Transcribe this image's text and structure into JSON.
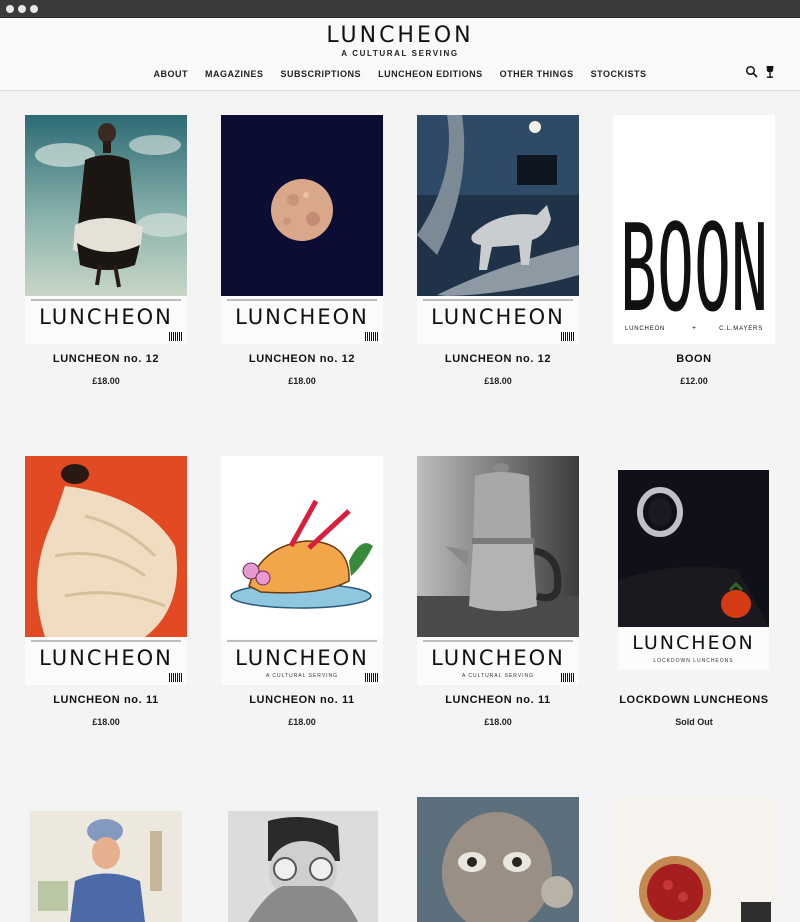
{
  "header": {
    "logo": "LUNCHEON",
    "tagline": "A CULTURAL SERVING",
    "nav": [
      "ABOUT",
      "MAGAZINES",
      "SUBSCRIPTIONS",
      "LUNCHEON EDITIONS",
      "OTHER THINGS",
      "STOCKISTS"
    ]
  },
  "products": [
    {
      "title": "LUNCHEON no. 12",
      "price": "£18.00",
      "cover_word": "LUNCHEON",
      "cover_sub": ""
    },
    {
      "title": "LUNCHEON no. 12",
      "price": "£18.00",
      "cover_word": "LUNCHEON",
      "cover_sub": ""
    },
    {
      "title": "LUNCHEON no. 12",
      "price": "£18.00",
      "cover_word": "LUNCHEON",
      "cover_sub": ""
    },
    {
      "title": "BOON",
      "price": "£12.00",
      "cover_word": "BOON",
      "cover_left": "LUNCHEON",
      "cover_mid": "+",
      "cover_right": "C.L.MAYERS"
    },
    {
      "title": "LUNCHEON no. 11",
      "price": "£18.00",
      "cover_word": "LUNCHEON",
      "cover_sub": ""
    },
    {
      "title": "LUNCHEON no. 11",
      "price": "£18.00",
      "cover_word": "LUNCHEON",
      "cover_sub": "A CULTURAL SERVING"
    },
    {
      "title": "LUNCHEON no. 11",
      "price": "£18.00",
      "cover_word": "LUNCHEON",
      "cover_sub": "A CULTURAL SERVING"
    },
    {
      "title": "LOCKDOWN LUNCHEONS",
      "price": "Sold Out",
      "cover_word": "LUNCHEON",
      "cover_sub": "LOCKDOWN LUNCHEONS"
    }
  ],
  "colors": {
    "page_bg": "#f4f4f4",
    "header_bg": "#f9f9f9",
    "text": "#111111"
  },
  "icons": [
    "search-icon",
    "wine-glass-icon"
  ]
}
